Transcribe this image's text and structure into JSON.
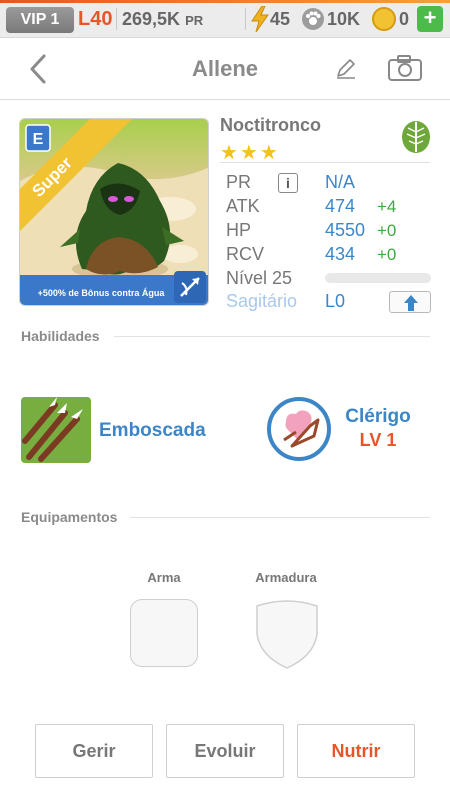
{
  "status_bar": {
    "vip": "VIP 1",
    "player_level": "L40",
    "power": "269,5K",
    "power_unit": "PR",
    "energy": "45",
    "paw_currency": "10K",
    "coins": "0",
    "add_label": "+"
  },
  "header": {
    "title": "Allene"
  },
  "hero": {
    "name": "Noctitronco",
    "stars": "★★★",
    "rarity_ribbon": "Super",
    "tier_badge": "E",
    "bonus_text": "+500% de Bônus contra Água",
    "element": "leaf-icon"
  },
  "stats": {
    "pr_label": "PR",
    "pr_value": "N/A",
    "info_label": "i",
    "atk_label": "ATK",
    "atk_value": "474",
    "atk_bonus": "+4",
    "hp_label": "HP",
    "hp_value": "4550",
    "hp_bonus": "+0",
    "rcv_label": "RCV",
    "rcv_value": "434",
    "rcv_bonus": "+0",
    "level_label": "Nível 25",
    "level_progress": 0.0,
    "constellation": "Sagitário",
    "constellation_level": "L0"
  },
  "skills": {
    "section_label": "Habilidades",
    "skill1_name": "Emboscada",
    "skill2_name": "Clérigo",
    "skill2_level": "LV 1"
  },
  "equipment": {
    "section_label": "Equipamentos",
    "weapon_label": "Arma",
    "armor_label": "Armadura"
  },
  "actions": {
    "manage": "Gerir",
    "evolve": "Evoluir",
    "feed": "Nutrir"
  },
  "colors": {
    "accent_orange": "#e8552a",
    "link_blue": "#3c86c8",
    "bonus_green": "#3eab3e",
    "star_yellow": "#f3c21c"
  }
}
